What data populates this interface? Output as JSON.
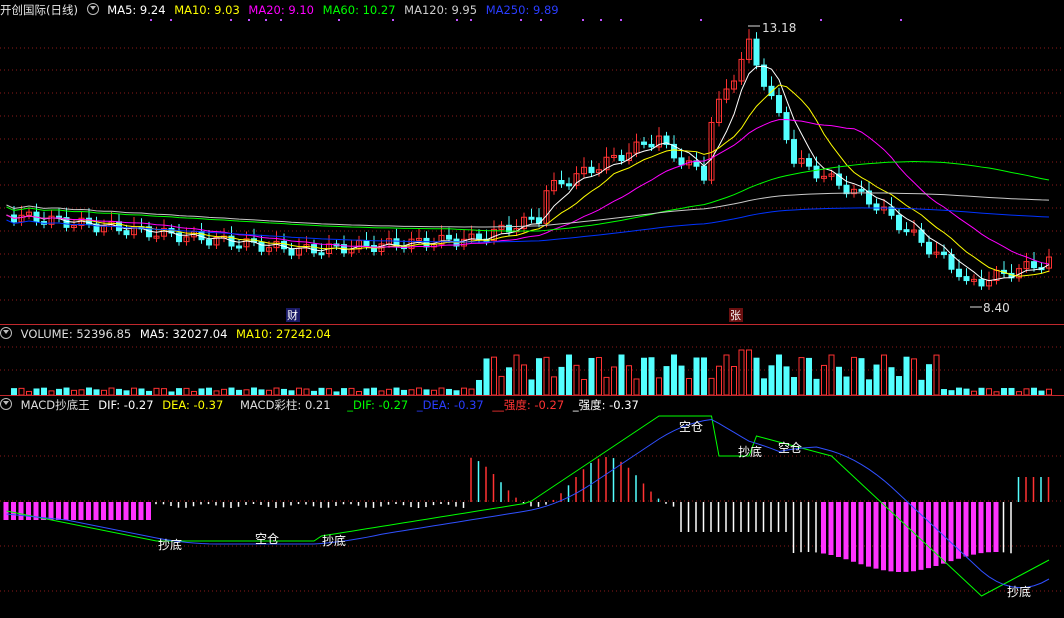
{
  "main": {
    "title": "开创国际(日线)",
    "ma": [
      {
        "label": "MA5: 9.24",
        "color": "#ffffff"
      },
      {
        "label": "MA10: 9.03",
        "color": "#ffff00"
      },
      {
        "label": "MA20: 9.10",
        "color": "#ff00ff"
      },
      {
        "label": "MA60: 10.27",
        "color": "#00ff00"
      },
      {
        "label": "MA120: 9.95",
        "color": "#c8c8c8"
      },
      {
        "label": "MA250: 9.89",
        "color": "#0033ff"
      }
    ],
    "high_label": "13.18",
    "low_label": "8.40",
    "marker_cai": "财",
    "marker_zhang": "张"
  },
  "volume": {
    "label": "VOLUME: 52396.85",
    "ma5": "MA5: 32027.04",
    "ma10": "MA10: 27242.04"
  },
  "macd": {
    "title": "MACD抄底王",
    "dif": "DIF: -0.27",
    "dea": "DEA: -0.37",
    "bar": "MACD彩柱: 0.21",
    "dif2": "_DIF: -0.27",
    "dea2": "_DEA: -0.37",
    "strength_red": "__强度: -0.27",
    "strength": "_强度: -0.37",
    "signal_buy": "抄底",
    "signal_empty": "空仓"
  },
  "colors": {
    "up": "#ff3232",
    "down": "#54ffff",
    "grid": "#8b1a1a"
  }
}
